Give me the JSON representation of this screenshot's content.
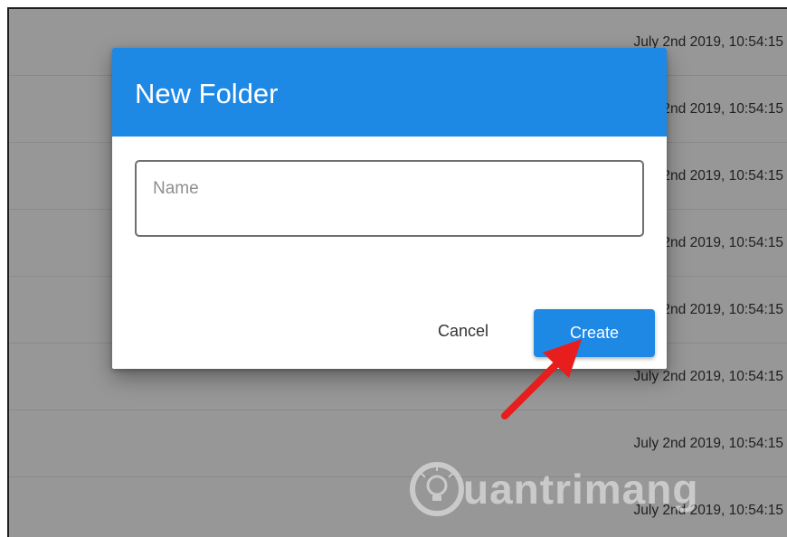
{
  "background_list": {
    "rows": [
      {
        "date": "July 2nd 2019, 10:54:15"
      },
      {
        "date": "July 2nd 2019, 10:54:15"
      },
      {
        "date": "July 2nd 2019, 10:54:15"
      },
      {
        "date": "July 2nd 2019, 10:54:15"
      },
      {
        "date": "July 2nd 2019, 10:54:15"
      },
      {
        "date": "July 2nd 2019, 10:54:15"
      },
      {
        "date": "July 2nd 2019, 10:54:15"
      },
      {
        "date": "July 2nd 2019, 10:54:15"
      }
    ]
  },
  "dialog": {
    "title": "New Folder",
    "name_field": {
      "placeholder": "Name",
      "value": ""
    },
    "cancel_label": "Cancel",
    "create_label": "Create"
  },
  "annotation": {
    "icon": "red-arrow-icon",
    "color": "#e81d1d"
  },
  "watermark": {
    "text": "uantrimang",
    "icon": "lightbulb-logo-icon"
  },
  "colors": {
    "accent": "#1e88e5",
    "overlay": "#979797"
  }
}
